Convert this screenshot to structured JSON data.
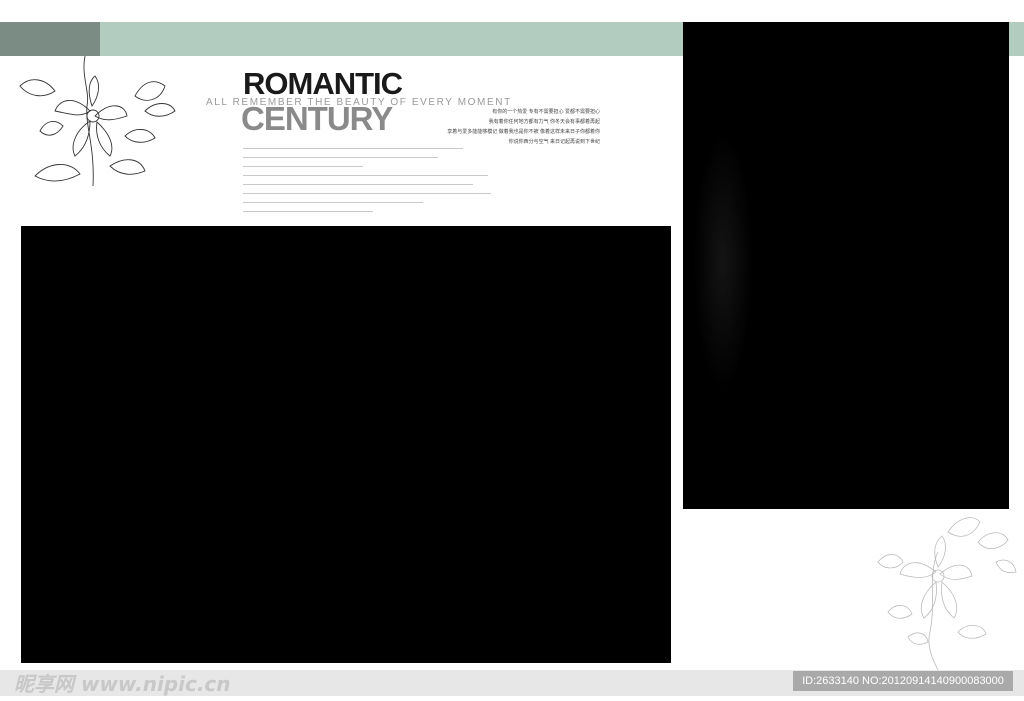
{
  "header": {
    "title_top": "ROMANTIC",
    "subtitle": "ALL REMEMBER THE BEAUTY OF EVERY MOMENT",
    "title_bottom": "CENTURY"
  },
  "poem": {
    "lines": [
      "有你的一个热爱  专有不需要担心  爱都不需要担心",
      "我有着你任何地方都有力气  你冬天会有事都着再起",
      "享着与爱多能能够模记  做着我也是你不被  像着这样未来日子你都着你",
      "你说你西分与空气  来日记起再说到下世纪"
    ]
  },
  "footer": {
    "logo": "昵享网 www.nipic.cn",
    "id_text": "ID:2633140 NO:20120914140900083000"
  },
  "colors": {
    "band": "#b2cdc0",
    "band_dark": "#7a8c83",
    "photo": "#000000"
  }
}
